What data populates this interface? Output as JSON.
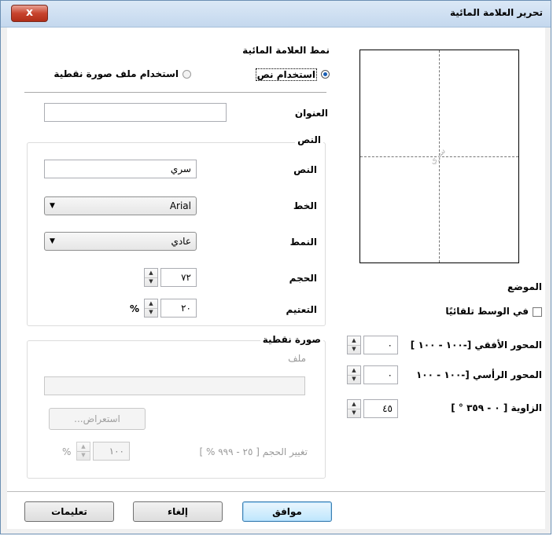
{
  "window": {
    "title": "تحرير العلامة المائية",
    "close_label": "x"
  },
  "style": {
    "heading": "نمط العلامة المائية",
    "use_text": "استخدام نص",
    "use_bitmap": "استخدام ملف صورة نقطية",
    "selected": "use_text"
  },
  "title_field": {
    "label": "العنوان",
    "value": ""
  },
  "text_group": {
    "title": "النص",
    "text_label": "النص",
    "text_value": "سري",
    "font_label": "الخط",
    "font_value": "Arial",
    "style_label": "النمط",
    "style_value": "عادي",
    "size_label": "الحجم",
    "size_value": "٧٢",
    "shade_label": "التعتيم",
    "shade_value": "٢٠",
    "shade_unit": "%"
  },
  "bitmap_group": {
    "title": "صورة نقطية",
    "file_label": "ملف",
    "file_value": "",
    "browse_label": "استعراض...",
    "scale_label": "تغيير الحجم [ ٢٥ - ٩٩٩ % ]",
    "scale_value": "١٠٠",
    "scale_unit": "%"
  },
  "preview": {
    "watermark_text": "سري"
  },
  "position": {
    "heading": "الموضع",
    "center_label": "في الوسط تلقائيًا",
    "center_checked": false,
    "x_label": "المحور الأفقي [-١٠٠ - ١٠٠ ]",
    "x_value": "٠",
    "y_label": "المحور الرأسي [-١٠٠ - ١٠٠",
    "y_value": "٠",
    "angle_label": "الزاوية [ ٠ - ٣٥٩ ° ]",
    "angle_value": "٤٥"
  },
  "buttons": {
    "ok": "موافق",
    "cancel": "إلغاء",
    "help": "تعليمات"
  },
  "colors": {
    "accent": "#3c7fb1",
    "titlebar": "#c4d8ee",
    "close": "#c7432d"
  }
}
